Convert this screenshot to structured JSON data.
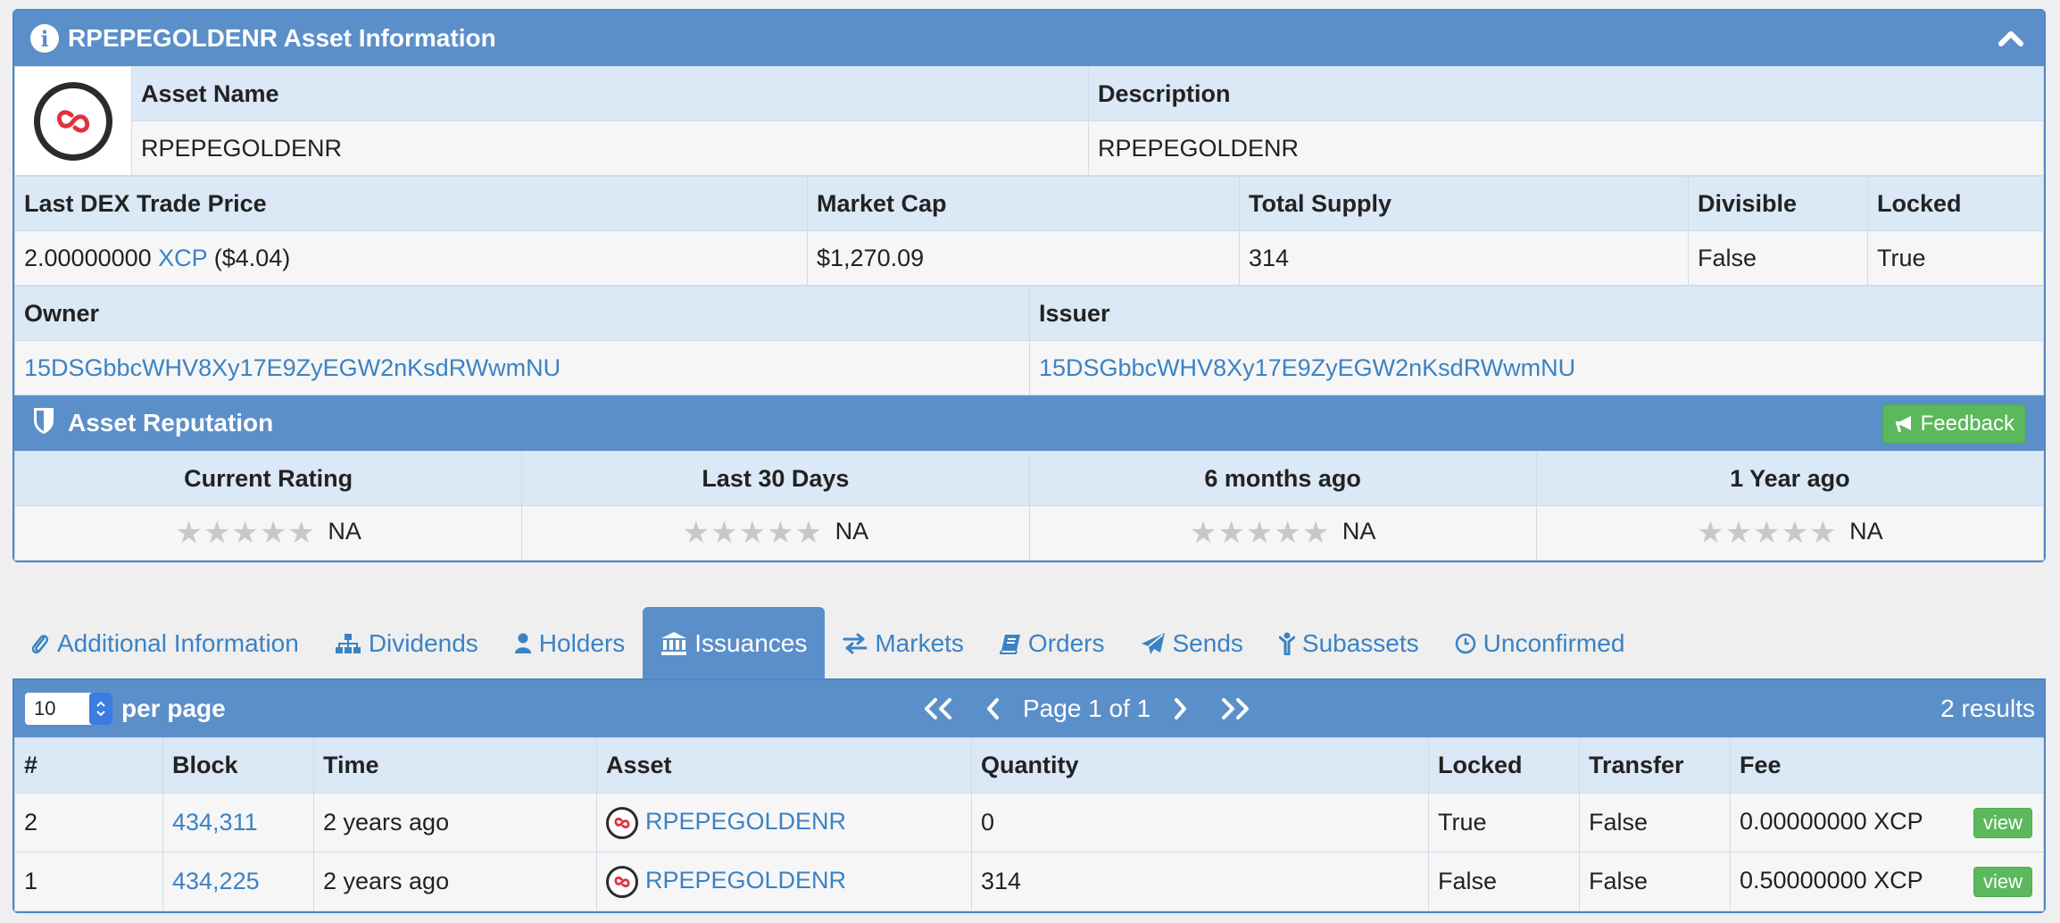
{
  "asset_panel": {
    "title": "RPEPEGOLDENR Asset Information",
    "asset_name_label": "Asset Name",
    "asset_name": "RPEPEGOLDENR",
    "description_label": "Description",
    "description": "RPEPEGOLDENR",
    "last_price_label": "Last DEX Trade Price",
    "last_price_value": "2.00000000",
    "last_price_unit": "XCP",
    "last_price_usd": "($4.04)",
    "market_cap_label": "Market Cap",
    "market_cap": "$1,270.09",
    "total_supply_label": "Total Supply",
    "total_supply": "314",
    "divisible_label": "Divisible",
    "divisible": "False",
    "locked_label": "Locked",
    "locked": "True",
    "owner_label": "Owner",
    "owner": "15DSGbbcWHV8Xy17E9ZyEGW2nKsdRWwmNU",
    "issuer_label": "Issuer",
    "issuer": "15DSGbbcWHV8Xy17E9ZyEGW2nKsdRWwmNU"
  },
  "reputation": {
    "title": "Asset Reputation",
    "feedback_label": "Feedback",
    "columns": [
      {
        "label": "Current Rating",
        "value": "NA",
        "stars": 0
      },
      {
        "label": "Last 30 Days",
        "value": "NA",
        "stars": 0
      },
      {
        "label": "6 months ago",
        "value": "NA",
        "stars": 0
      },
      {
        "label": "1 Year ago",
        "value": "NA",
        "stars": 0
      }
    ]
  },
  "tabs": [
    {
      "label": "Additional Information",
      "icon": "paperclip-icon"
    },
    {
      "label": "Dividends",
      "icon": "sitemap-icon"
    },
    {
      "label": "Holders",
      "icon": "user-icon"
    },
    {
      "label": "Issuances",
      "icon": "bank-icon",
      "active": true
    },
    {
      "label": "Markets",
      "icon": "exchange-icon"
    },
    {
      "label": "Orders",
      "icon": "book-icon"
    },
    {
      "label": "Sends",
      "icon": "paper-plane-icon"
    },
    {
      "label": "Subassets",
      "icon": "child-icon"
    },
    {
      "label": "Unconfirmed",
      "icon": "clock-icon"
    }
  ],
  "issuances": {
    "per_page_value": "10",
    "per_page_label": "per page",
    "page_text": "Page 1 of 1",
    "results": "2 results",
    "headers": [
      "#",
      "Block",
      "Time",
      "Asset",
      "Quantity",
      "Locked",
      "Transfer",
      "Fee"
    ],
    "rows": [
      {
        "num": "2",
        "block": "434,311",
        "time": "2 years ago",
        "asset": "RPEPEGOLDENR",
        "quantity": "0",
        "locked": "True",
        "transfer": "False",
        "fee": "0.00000000 XCP",
        "action": "view"
      },
      {
        "num": "1",
        "block": "434,225",
        "time": "2 years ago",
        "asset": "RPEPEGOLDENR",
        "quantity": "314",
        "locked": "False",
        "transfer": "False",
        "fee": "0.50000000 XCP",
        "action": "view"
      }
    ]
  },
  "colors": {
    "header_blue": "#5b8fc9",
    "label_bg": "#dbe8f5",
    "link": "#3b82c4",
    "success": "#5cb85c"
  }
}
